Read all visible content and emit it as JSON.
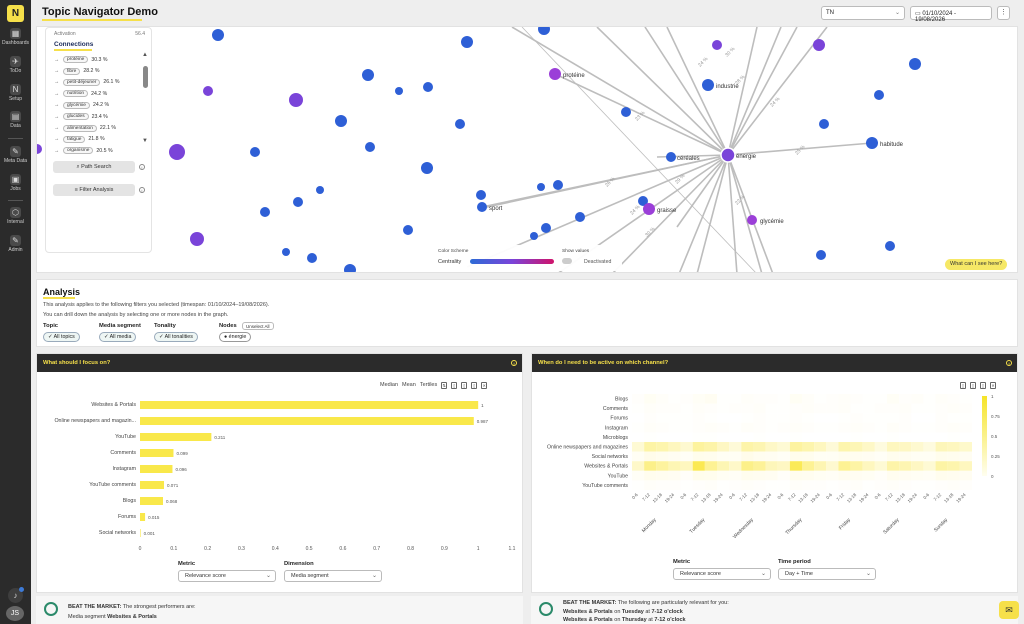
{
  "app": {
    "title": "Topic Navigator Demo",
    "logo_letter": "N"
  },
  "rail": {
    "items": [
      {
        "label": "Dashboards",
        "icon": "dashboard-icon",
        "glyph": "▦"
      },
      {
        "label": "ToDo",
        "icon": "rocket-icon",
        "glyph": "✈"
      },
      {
        "label": "Setup",
        "icon": "setup-icon",
        "glyph": "N"
      },
      {
        "label": "Data",
        "icon": "data-icon",
        "glyph": "▤"
      },
      {
        "label": "Meta Data",
        "icon": "wrench-icon",
        "glyph": "✎"
      },
      {
        "label": "Jobs",
        "icon": "jobs-icon",
        "glyph": "▣"
      },
      {
        "label": "Internal",
        "icon": "internal-icon",
        "glyph": "⬡"
      },
      {
        "label": "Admin",
        "icon": "admin-icon",
        "glyph": "✎"
      }
    ],
    "avatar": "JS"
  },
  "topbar": {
    "country": "TN",
    "date_range": "01/10/2024 - 19/08/2026",
    "more": "⋮"
  },
  "graph": {
    "activation_label": "Activation",
    "activation_value": "56.4",
    "connections_title": "Connections",
    "connections": [
      {
        "term": "protéine",
        "pct": "30.3 %"
      },
      {
        "term": "fibre",
        "pct": "28.2 %"
      },
      {
        "term": "petit-déjeuner",
        "pct": "26.1 %"
      },
      {
        "term": "nutrition",
        "pct": "24.2 %"
      },
      {
        "term": "glycémie",
        "pct": "24.2 %"
      },
      {
        "term": "glucides",
        "pct": "23.4 %"
      },
      {
        "term": "alimentation",
        "pct": "22.1 %"
      },
      {
        "term": "fatigue",
        "pct": "21.8 %"
      },
      {
        "term": "organisme",
        "pct": "20.5 %"
      }
    ],
    "path_search": "Path Search",
    "filter_analysis": "Filter Analysis",
    "center_node": "énergie",
    "labeled_nodes": [
      "protéine",
      "industrie",
      "céréales",
      "habitude",
      "sport",
      "graisse",
      "glycémie"
    ],
    "edge_labels": [
      "30 %",
      "24 %",
      "28 %",
      "23 %",
      "26 %",
      "29 %",
      "24 %",
      "22 %",
      "30 %",
      "25 %",
      "24 %"
    ],
    "legend": {
      "color_scheme": "Color Scheme",
      "centrality": "Centrality",
      "show_values": "Show values",
      "deactivated": "Deactivated"
    },
    "what_can_i_see": "What can I see here?",
    "colors": {
      "blue": "#2e5fd6",
      "purple": "#7a44d9",
      "violet": "#9b3fd8",
      "edge": "#bdbdbd"
    }
  },
  "analysis": {
    "title": "Analysis",
    "line1": "This analysis applies to the following filters you selected (timespan: 01/10/2024–19/08/2026).",
    "line2": "You can drill down the analysis by selecting one or more nodes in the graph.",
    "filters": [
      {
        "label": "Topic",
        "chip": "All topics"
      },
      {
        "label": "Media segment",
        "chip": "All media"
      },
      {
        "label": "Tonality",
        "chip": "All tonalities"
      },
      {
        "label": "Nodes",
        "chip": "énergie"
      }
    ],
    "unselect_all": "Unselect All"
  },
  "focus_card": {
    "title": "What should I focus on?",
    "toolbar": [
      "Median",
      "Mean",
      "Tertiles"
    ],
    "metric_label": "Metric",
    "metric_value": "Relevance score",
    "dimension_label": "Dimension",
    "dimension_value": "Media segment",
    "beat_prefix": "BEAT THE MARKET:",
    "beat_text": " The strongest performers are:",
    "beat_line2_prefix": "Media segment ",
    "beat_line2_value": "Websites & Portals"
  },
  "channel_card": {
    "title": "When do I need to be active on which channel?",
    "metric_label": "Metric",
    "metric_value": "Relevance score",
    "period_label": "Time period",
    "period_value": "Day + Time",
    "beat_prefix": "BEAT THE MARKET:",
    "beat_text": " The following are particularly relevant for you:",
    "beat_line2": {
      "channel": "Websites & Portals",
      "on": " on ",
      "day": "Tuesday",
      "at": " at ",
      "time": "7-12 o'clock"
    },
    "beat_line3": {
      "channel": "Websites & Portals",
      "on": " on ",
      "day": "Thursday",
      "at": " at ",
      "time": "7-12 o'clock"
    }
  },
  "chart_data": [
    {
      "type": "bar",
      "orientation": "horizontal",
      "categories": [
        "Websites & Portals",
        "Online newspapers and magazin...",
        "YouTube",
        "Comments",
        "Instagram",
        "YouTube comments",
        "Blogs",
        "Forums",
        "Social networks"
      ],
      "values": [
        1,
        0.987,
        0.211,
        0.099,
        0.096,
        0.071,
        0.068,
        0.015,
        0.001
      ],
      "value_labels": [
        "1",
        "0.987",
        "0.211",
        "0.099",
        "0.096",
        "0.071",
        "0.068",
        "0.015",
        "0.001"
      ],
      "xlim": [
        0,
        1.1
      ],
      "xticks": [
        "0",
        "0.1",
        "0.2",
        "0.3",
        "0.4",
        "0.5",
        "0.6",
        "0.7",
        "0.8",
        "0.9",
        "1",
        "1.1"
      ],
      "color": "#f9e84a"
    },
    {
      "type": "heatmap",
      "rows": [
        "Blogs",
        "Comments",
        "Forums",
        "Instagram",
        "Microblogs",
        "Online newspapers and magazines",
        "Social networks",
        "Websites & Portals",
        "YouTube",
        "YouTube comments"
      ],
      "days": [
        "Monday",
        "Tuesday",
        "Wednesday",
        "Thursday",
        "Friday",
        "Saturday",
        "Sunday"
      ],
      "slots": [
        "0-6",
        "7-12",
        "13-18",
        "19-24"
      ],
      "colorbar": [
        "1",
        "0.75",
        "0.5",
        "0.25",
        "0"
      ],
      "values": [
        [
          0.02,
          0.05,
          0.03,
          0.01,
          0.02,
          0.04,
          0.06,
          0.01,
          0.01,
          0.03,
          0.02,
          0.02,
          0.01,
          0.05,
          0.03,
          0.01,
          0.02,
          0.03,
          0.02,
          0.01,
          0.01,
          0.04,
          0.02,
          0.03,
          0.01,
          0.03,
          0.02,
          0.01
        ],
        [
          0.01,
          0.03,
          0.02,
          0.02,
          0.01,
          0.03,
          0.02,
          0.01,
          0.02,
          0.02,
          0.03,
          0.01,
          0.01,
          0.02,
          0.03,
          0.02,
          0.02,
          0.03,
          0.01,
          0.01,
          0.02,
          0.02,
          0.03,
          0.01,
          0.01,
          0.02,
          0.03,
          0.02
        ],
        [
          0.0,
          0.02,
          0.01,
          0.01,
          0.01,
          0.02,
          0.01,
          0.0,
          0.0,
          0.01,
          0.02,
          0.01,
          0.01,
          0.02,
          0.01,
          0.0,
          0.0,
          0.01,
          0.02,
          0.01,
          0.01,
          0.01,
          0.02,
          0.0,
          0.0,
          0.02,
          0.01,
          0.01
        ],
        [
          0.01,
          0.03,
          0.02,
          0.01,
          0.01,
          0.02,
          0.03,
          0.02,
          0.01,
          0.03,
          0.02,
          0.01,
          0.02,
          0.03,
          0.02,
          0.01,
          0.01,
          0.02,
          0.03,
          0.02,
          0.01,
          0.03,
          0.02,
          0.01,
          0.01,
          0.02,
          0.03,
          0.02
        ],
        [
          0.0,
          0.01,
          0.0,
          0.0,
          0.0,
          0.01,
          0.01,
          0.0,
          0.0,
          0.0,
          0.01,
          0.0,
          0.0,
          0.01,
          0.0,
          0.0,
          0.0,
          0.0,
          0.01,
          0.0,
          0.0,
          0.01,
          0.0,
          0.0,
          0.0,
          0.0,
          0.01,
          0.0
        ],
        [
          0.2,
          0.42,
          0.38,
          0.3,
          0.22,
          0.45,
          0.4,
          0.28,
          0.18,
          0.4,
          0.36,
          0.26,
          0.2,
          0.44,
          0.38,
          0.3,
          0.18,
          0.38,
          0.34,
          0.26,
          0.15,
          0.3,
          0.28,
          0.22,
          0.15,
          0.32,
          0.3,
          0.24
        ],
        [
          0.05,
          0.1,
          0.08,
          0.06,
          0.04,
          0.09,
          0.08,
          0.05,
          0.05,
          0.1,
          0.07,
          0.06,
          0.04,
          0.09,
          0.08,
          0.05,
          0.05,
          0.08,
          0.07,
          0.06,
          0.04,
          0.08,
          0.07,
          0.05,
          0.05,
          0.09,
          0.08,
          0.06
        ],
        [
          0.25,
          0.55,
          0.45,
          0.35,
          0.3,
          0.8,
          0.5,
          0.35,
          0.25,
          0.55,
          0.48,
          0.32,
          0.28,
          0.78,
          0.5,
          0.36,
          0.22,
          0.5,
          0.42,
          0.3,
          0.2,
          0.4,
          0.36,
          0.28,
          0.2,
          0.42,
          0.38,
          0.3
        ],
        [
          0.04,
          0.08,
          0.07,
          0.06,
          0.03,
          0.09,
          0.08,
          0.05,
          0.04,
          0.08,
          0.07,
          0.06,
          0.03,
          0.08,
          0.07,
          0.05,
          0.04,
          0.07,
          0.06,
          0.05,
          0.03,
          0.07,
          0.06,
          0.05,
          0.04,
          0.08,
          0.07,
          0.06
        ],
        [
          0.01,
          0.03,
          0.02,
          0.02,
          0.01,
          0.02,
          0.03,
          0.01,
          0.02,
          0.03,
          0.02,
          0.01,
          0.01,
          0.03,
          0.02,
          0.02,
          0.01,
          0.02,
          0.03,
          0.01,
          0.02,
          0.03,
          0.02,
          0.01,
          0.01,
          0.02,
          0.03,
          0.02
        ]
      ]
    }
  ]
}
